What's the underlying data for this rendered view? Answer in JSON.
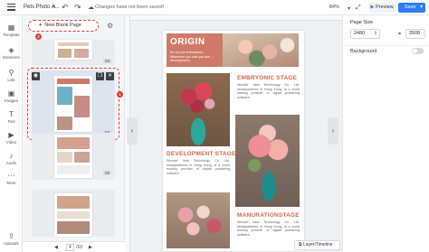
{
  "app": {
    "title": "Pets Photo A...",
    "status": "Changes have not been saved!",
    "zoom": "84%",
    "preview_label": "Preview",
    "save_label": "Save",
    "accent": "#2f7bf5",
    "highlight": "#e23b3b"
  },
  "nav": {
    "items": [
      {
        "label": "Template",
        "icon": "template-icon"
      },
      {
        "label": "Elements",
        "icon": "elements-icon"
      },
      {
        "label": "Link",
        "icon": "link-icon"
      },
      {
        "label": "Images",
        "icon": "images-icon"
      },
      {
        "label": "Text",
        "icon": "text-icon"
      },
      {
        "label": "Video",
        "icon": "video-icon"
      },
      {
        "label": "Audio",
        "icon": "audio-icon"
      },
      {
        "label": "More",
        "icon": "more-icon"
      },
      {
        "label": "Uploads",
        "icon": "uploads-icon"
      }
    ]
  },
  "pages": {
    "new_page_label": "New Blank Page",
    "badge_new": "2",
    "badge_selected": "1",
    "thumb_numbers": [
      "03",
      "04",
      "05"
    ],
    "current": "4",
    "total": "/10"
  },
  "document": {
    "origin_title": "ORIGIN",
    "origin_text": "It's not our enthusiasm, Whenever you said you are ... development...",
    "section1_title": "EMBRYONIC STAGE",
    "section1_text": "Wonder Idea Technology Co. Ltd. headquartered in Hong Kong, is a world leading provider of digital publishing software.",
    "section2_title": "DEVELOPMENT STAGE",
    "section2_text": "Wonder Idea Technology Co. Ltd. headquartered in Hong Kong, is a world leading provider of digital publishing software.",
    "section3_title": "MANURATIONSTAGE",
    "section3_text": "Wonder Idea Technology Co. Ltd. headquartered in Hong Kong, is a world leading provider of digital publishing software."
  },
  "canvas": {
    "layer_button": "Layer/Timeline"
  },
  "right_panel": {
    "page_size_label": "Page Size",
    "width": "2480",
    "height": "3508",
    "background_label": "Background"
  }
}
